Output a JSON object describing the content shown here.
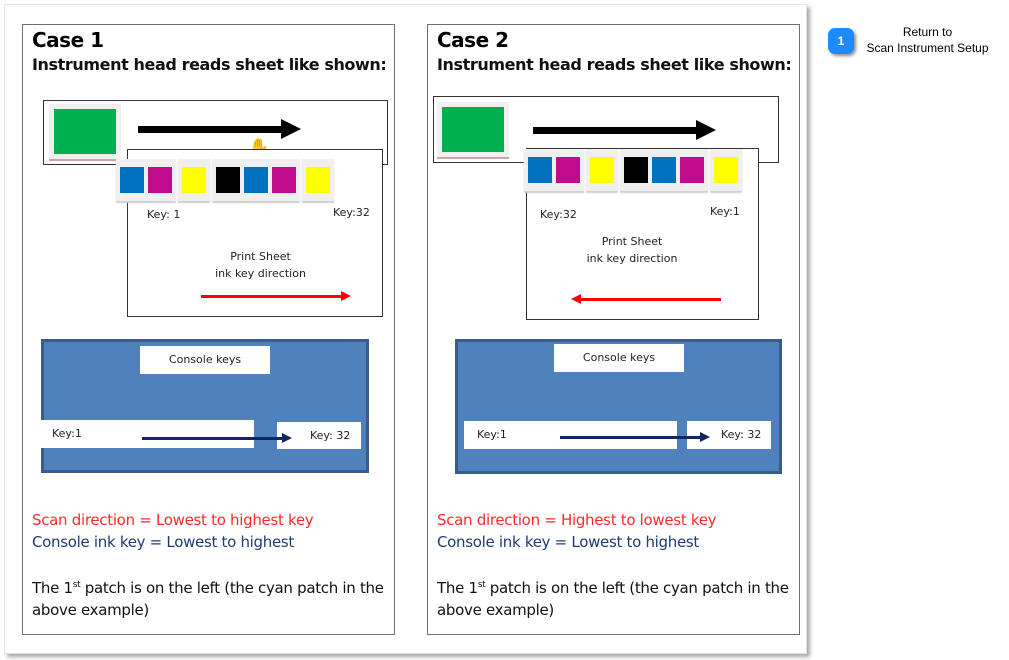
{
  "colors": {
    "cyan": "#0070c0",
    "magenta": "#c00c8c",
    "yellow": "#ffff00",
    "black": "#000000",
    "green": "#00b050",
    "console_blue": "#4f81bd",
    "scan_text": "#ff2a2a",
    "console_text": "#1f3b73"
  },
  "patch_strip": [
    "cyan",
    "magenta",
    "yellow",
    "black",
    "cyan",
    "magenta",
    "yellow"
  ],
  "side_link": {
    "badge": "1",
    "line1": "Return to",
    "line2": "Scan Instrument Setup",
    "icon": "number-badge-icon"
  },
  "cases": [
    {
      "title": "Case 1",
      "subtitle": "Instrument head reads sheet like shown:",
      "key_left": "Key: 1",
      "key_right": "Key:32",
      "sheet_caption_1": "Print Sheet",
      "sheet_caption_2": "ink key direction",
      "ink_direction": "right",
      "console_title": "Console keys",
      "console_key_left": "Key:1",
      "console_key_right": "Key: 32",
      "scan_line": "Scan direction = Lowest to highest key",
      "console_line": "Console ink key = Lowest to highest",
      "patch_pre": "The 1",
      "patch_sup": "st",
      "patch_post": " patch is on the left (the cyan patch in the above example)"
    },
    {
      "title": "Case 2",
      "subtitle": "Instrument head reads sheet like shown:",
      "key_left": "Key:32",
      "key_right": "Key:1",
      "sheet_caption_1": "Print Sheet",
      "sheet_caption_2": "ink key direction",
      "ink_direction": "left",
      "console_title": "Console keys",
      "console_key_left": "Key:1",
      "console_key_right": "Key: 32",
      "scan_line": "Scan direction = Highest to lowest key",
      "console_line": "Console ink key = Lowest to highest",
      "patch_pre": "The 1",
      "patch_sup": "st",
      "patch_post": " patch is on the left (the cyan patch in the above example)"
    }
  ]
}
